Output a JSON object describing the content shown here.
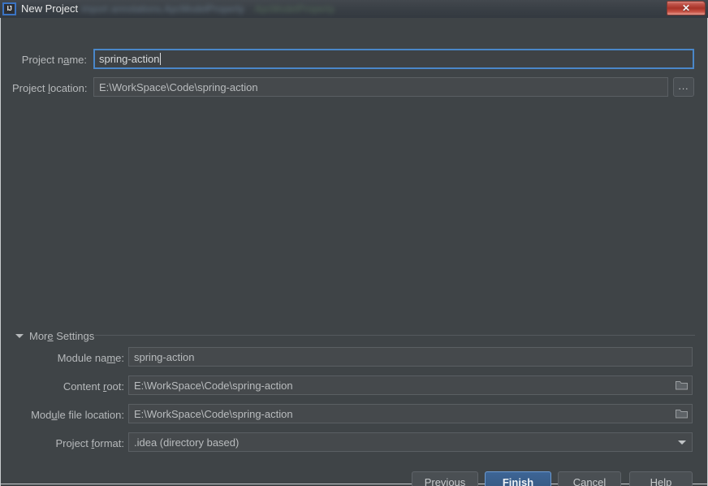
{
  "window": {
    "title": "New Project",
    "app_icon": "intellij-idea-icon",
    "icon_text": "IJ",
    "close_label": "✕",
    "background_blur_text_1": "import annotations.ApcModelProperty",
    "background_blur_text_2": "ApcModelProperty"
  },
  "form": {
    "project_name": {
      "label_before": "Project n",
      "label_mnemonic": "a",
      "label_after": "me:",
      "value": "spring-action",
      "focused": true
    },
    "project_location": {
      "label_before": "Project ",
      "label_mnemonic": "l",
      "label_after": "ocation:",
      "value": "E:\\WorkSpace\\Code\\spring-action",
      "browse_label": "...",
      "browse_icon": "ellipsis-icon"
    }
  },
  "more_settings": {
    "label_before": "Mor",
    "label_mnemonic": "e",
    "label_after": " Settings",
    "expanded": true,
    "toggle_icon": "triangle-down-icon",
    "fields": {
      "module_name": {
        "label_before": "Module na",
        "label_mnemonic": "m",
        "label_after": "e:",
        "value": "spring-action"
      },
      "content_root": {
        "label_before": "Content ",
        "label_mnemonic": "r",
        "label_after": "oot:",
        "value": "E:\\WorkSpace\\Code\\spring-action",
        "browse_icon": "folder-icon"
      },
      "module_file_location": {
        "label_before": "Mod",
        "label_mnemonic": "u",
        "label_after": "le file location:",
        "value": "E:\\WorkSpace\\Code\\spring-action",
        "browse_icon": "folder-icon"
      },
      "project_format": {
        "label_before": "Project ",
        "label_mnemonic": "f",
        "label_after": "ormat:",
        "value": ".idea (directory based)",
        "dropdown_icon": "chevron-down-icon"
      }
    }
  },
  "buttons": {
    "previous": {
      "before": "",
      "mnemonic": "P",
      "after": "revious"
    },
    "finish": {
      "before": "",
      "mnemonic": "F",
      "after": "inish",
      "is_default": true
    },
    "cancel": {
      "before": "Cancel",
      "mnemonic": "",
      "after": ""
    },
    "help": {
      "before": "Help",
      "mnemonic": "",
      "after": ""
    }
  },
  "colors": {
    "dialog_background": "#3f4447",
    "titlebar": "#3a4046",
    "field_background": "#45494c",
    "focus_border": "#4a87c9",
    "default_button": "#3d6596",
    "close_button": "#a83328",
    "text": "#b6b9bb"
  }
}
